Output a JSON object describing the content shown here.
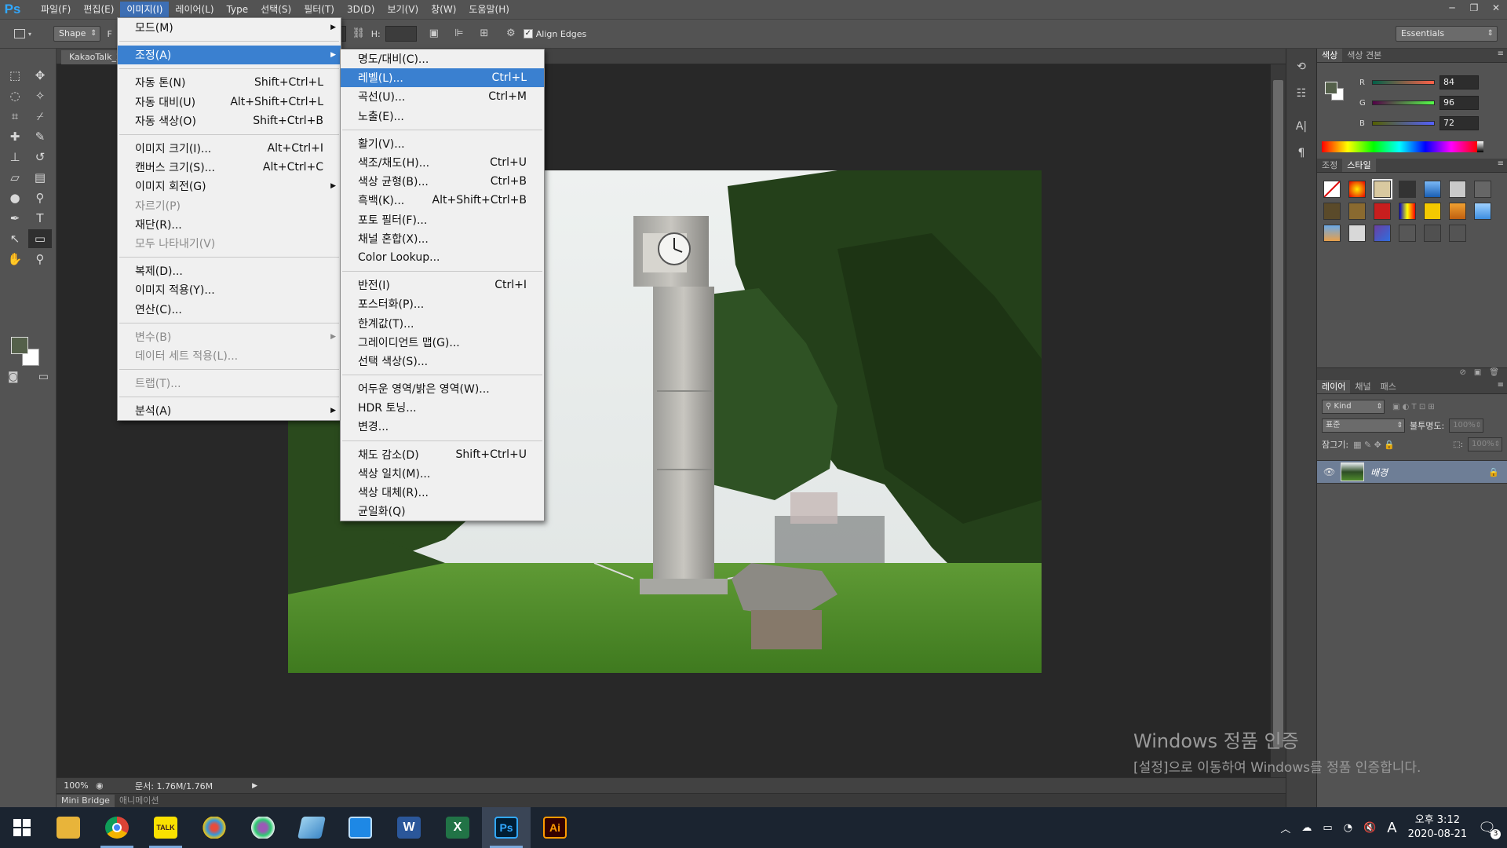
{
  "app": {
    "logo": "Ps"
  },
  "menubar": {
    "items": [
      "파일(F)",
      "편집(E)",
      "이미지(I)",
      "레이어(L)",
      "Type",
      "선택(S)",
      "필터(T)",
      "3D(D)",
      "보기(V)",
      "창(W)",
      "도움말(H)"
    ],
    "active_index": 2
  },
  "options_bar": {
    "mode": "Shape",
    "w_prefix": "F",
    "h_label": "H:",
    "align_edges": "Align Edges",
    "align_edges_checked": true,
    "workspace": "Essentials"
  },
  "document": {
    "tab": "KakaoTalk_2"
  },
  "status": {
    "zoom": "100%",
    "doc_info": "문서: 1.76M/1.76M"
  },
  "bottom_tabs": {
    "mini_bridge": "Mini Bridge",
    "animation": "애니메이션"
  },
  "image_menu": {
    "items": [
      {
        "label": "모드(M)",
        "shortcut": "",
        "submenu": true,
        "disabled": false,
        "highlighted": false
      },
      {
        "sep": true
      },
      {
        "label": "조정(A)",
        "shortcut": "",
        "submenu": true,
        "disabled": false,
        "highlighted": true
      },
      {
        "sep": true
      },
      {
        "label": "자동 톤(N)",
        "shortcut": "Shift+Ctrl+L"
      },
      {
        "label": "자동 대비(U)",
        "shortcut": "Alt+Shift+Ctrl+L"
      },
      {
        "label": "자동 색상(O)",
        "shortcut": "Shift+Ctrl+B"
      },
      {
        "sep": true
      },
      {
        "label": "이미지 크기(I)...",
        "shortcut": "Alt+Ctrl+I"
      },
      {
        "label": "캔버스 크기(S)...",
        "shortcut": "Alt+Ctrl+C"
      },
      {
        "label": "이미지 회전(G)",
        "shortcut": "",
        "submenu": true
      },
      {
        "label": "자르기(P)",
        "shortcut": "",
        "disabled": true
      },
      {
        "label": "재단(R)...",
        "shortcut": ""
      },
      {
        "label": "모두 나타내기(V)",
        "shortcut": "",
        "disabled": true
      },
      {
        "sep": true
      },
      {
        "label": "복제(D)...",
        "shortcut": ""
      },
      {
        "label": "이미지 적용(Y)...",
        "shortcut": ""
      },
      {
        "label": "연산(C)...",
        "shortcut": ""
      },
      {
        "sep": true
      },
      {
        "label": "변수(B)",
        "shortcut": "",
        "submenu": true,
        "disabled": true
      },
      {
        "label": "데이터 세트 적용(L)...",
        "shortcut": "",
        "disabled": true
      },
      {
        "sep": true
      },
      {
        "label": "트랩(T)...",
        "shortcut": "",
        "disabled": true
      },
      {
        "sep": true
      },
      {
        "label": "분석(A)",
        "shortcut": "",
        "submenu": true
      }
    ]
  },
  "adjust_menu": {
    "items": [
      {
        "label": "명도/대비(C)...",
        "shortcut": ""
      },
      {
        "label": "레벨(L)...",
        "shortcut": "Ctrl+L",
        "highlighted": true
      },
      {
        "label": "곡선(U)...",
        "shortcut": "Ctrl+M"
      },
      {
        "label": "노출(E)...",
        "shortcut": ""
      },
      {
        "sep": true
      },
      {
        "label": "활기(V)...",
        "shortcut": ""
      },
      {
        "label": "색조/채도(H)...",
        "shortcut": "Ctrl+U"
      },
      {
        "label": "색상 균형(B)...",
        "shortcut": "Ctrl+B"
      },
      {
        "label": "흑백(K)...",
        "shortcut": "Alt+Shift+Ctrl+B"
      },
      {
        "label": "포토 필터(F)...",
        "shortcut": ""
      },
      {
        "label": "채널 혼합(X)...",
        "shortcut": ""
      },
      {
        "label": "Color Lookup...",
        "shortcut": ""
      },
      {
        "sep": true
      },
      {
        "label": "반전(I)",
        "shortcut": "Ctrl+I"
      },
      {
        "label": "포스터화(P)...",
        "shortcut": ""
      },
      {
        "label": "한계값(T)...",
        "shortcut": ""
      },
      {
        "label": "그레이디언트 맵(G)...",
        "shortcut": ""
      },
      {
        "label": "선택 색상(S)...",
        "shortcut": ""
      },
      {
        "sep": true
      },
      {
        "label": "어두운 영역/밝은 영역(W)...",
        "shortcut": ""
      },
      {
        "label": "HDR 토닝...",
        "shortcut": ""
      },
      {
        "label": "변경...",
        "shortcut": ""
      },
      {
        "sep": true
      },
      {
        "label": "채도 감소(D)",
        "shortcut": "Shift+Ctrl+U"
      },
      {
        "label": "색상 일치(M)...",
        "shortcut": ""
      },
      {
        "label": "색상 대체(R)...",
        "shortcut": ""
      },
      {
        "label": "균일화(Q)",
        "shortcut": ""
      }
    ]
  },
  "color_panel": {
    "tabs": [
      "색상",
      "색상 견본"
    ],
    "r_label": "R",
    "g_label": "G",
    "b_label": "B",
    "r": "84",
    "g": "96",
    "b": "72",
    "foreground": "#54604a"
  },
  "style_panel": {
    "tabs": [
      "조정",
      "스타일"
    ]
  },
  "layers_panel": {
    "tabs": [
      "레이어",
      "채널",
      "패스"
    ],
    "kind": "Kind",
    "blend": "표준",
    "opacity_label": "불투명도:",
    "opacity": "100%",
    "lock_label": "잠그기:",
    "fill": "100%",
    "layer_name": "배경"
  },
  "watermark": {
    "title": "Windows 정품 인증",
    "subtitle": "[설정]으로 이동하여 Windows를 정품 인증합니다."
  },
  "taskbar": {
    "apps": [
      "file-explorer",
      "chrome",
      "kakaotalk",
      "paint-app",
      "paint3d",
      "notepad",
      "calc",
      "word",
      "excel",
      "photoshop",
      "illustrator"
    ],
    "kakao_label": "TALK",
    "word_label": "W",
    "excel_label": "X",
    "ps_label": "Ps",
    "ai_label": "Ai",
    "ime": "A",
    "time": "오후 3:12",
    "date": "2020-08-21",
    "notifications": "3"
  }
}
